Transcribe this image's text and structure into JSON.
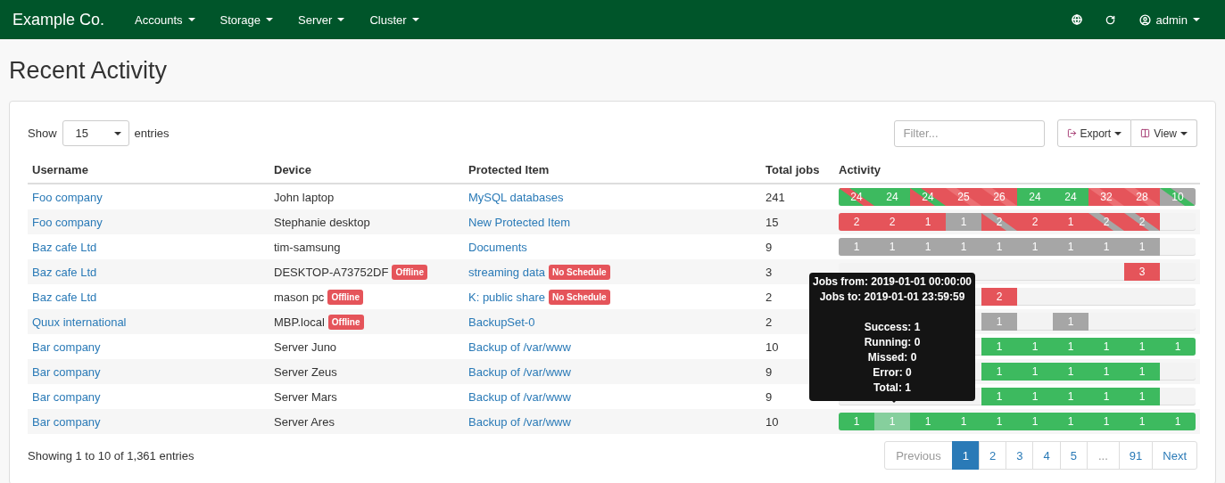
{
  "navbar": {
    "brand": "Example Co.",
    "menus": [
      {
        "label": "Accounts"
      },
      {
        "label": "Storage"
      },
      {
        "label": "Server"
      },
      {
        "label": "Cluster"
      }
    ],
    "user": "admin"
  },
  "page_title": "Recent Activity",
  "controls": {
    "show_label": "Show",
    "page_size": "15",
    "entries_label": "entries",
    "filter_placeholder": "Filter...",
    "export": "Export",
    "view": "View"
  },
  "table": {
    "columns": [
      "Username",
      "Device",
      "Protected Item",
      "Total jobs",
      "Activity"
    ],
    "rows": [
      {
        "username": "Foo company",
        "device": "John laptop",
        "item": "MySQL databases",
        "total": "241",
        "activity": [
          {
            "kind": "jobs",
            "label": "24",
            "color": "#3dba5f",
            "accent": {
              "color": "#e5545a"
            }
          },
          {
            "kind": "jobs",
            "label": "24",
            "color": "#3dba5f"
          },
          {
            "kind": "jobs",
            "label": "24",
            "color": "#e5545a",
            "accent": {
              "color": "#3dba5f"
            }
          },
          {
            "kind": "jobs",
            "label": "25",
            "color": "#e5545a",
            "accent": {
              "color": "#ec6f73"
            }
          },
          {
            "kind": "jobs",
            "label": "26",
            "color": "#e5545a",
            "accent": {
              "color": "#ec6f73"
            }
          },
          {
            "kind": "jobs",
            "label": "24",
            "color": "#3dba5f"
          },
          {
            "kind": "jobs",
            "label": "24",
            "color": "#3dba5f"
          },
          {
            "kind": "jobs",
            "label": "32",
            "color": "#e5545a",
            "accent": {
              "color": "#ec6f73"
            }
          },
          {
            "kind": "jobs",
            "label": "28",
            "color": "#e5545a",
            "accent": {
              "color": "#ec6f73"
            }
          },
          {
            "kind": "jobs",
            "label": "10",
            "color": "#a6a6a6",
            "accent": {
              "color": "#3dba5f"
            }
          }
        ]
      },
      {
        "username": "Foo company",
        "device": "Stephanie desktop",
        "item": "New Protected Item",
        "total": "15",
        "activity": [
          {
            "kind": "jobs",
            "label": "2",
            "color": "#e5545a"
          },
          {
            "kind": "jobs",
            "label": "2",
            "color": "#e5545a"
          },
          {
            "kind": "jobs",
            "label": "1",
            "color": "#e5545a"
          },
          {
            "kind": "jobs",
            "label": "1",
            "color": "#a6a6a6"
          },
          {
            "kind": "jobs",
            "label": "2",
            "color": "#e5545a",
            "accent": {
              "color": "#a6a6a6"
            }
          },
          {
            "kind": "jobs",
            "label": "2",
            "color": "#e5545a"
          },
          {
            "kind": "jobs",
            "label": "1",
            "color": "#e5545a"
          },
          {
            "kind": "jobs",
            "label": "2",
            "color": "#e5545a",
            "accent": {
              "color": "#a6a6a6"
            }
          },
          {
            "kind": "jobs",
            "label": "2",
            "color": "#e5545a",
            "accent": {
              "color": "#a6a6a6"
            }
          },
          {
            "kind": "empty"
          }
        ]
      },
      {
        "username": "Baz cafe Ltd",
        "device": "tim-samsung",
        "item": "Documents",
        "total": "9",
        "activity": [
          {
            "kind": "jobs",
            "label": "1",
            "color": "#a6a6a6"
          },
          {
            "kind": "jobs",
            "label": "1",
            "color": "#a6a6a6"
          },
          {
            "kind": "jobs",
            "label": "1",
            "color": "#a6a6a6"
          },
          {
            "kind": "jobs",
            "label": "1",
            "color": "#a6a6a6"
          },
          {
            "kind": "jobs",
            "label": "1",
            "color": "#a6a6a6"
          },
          {
            "kind": "jobs",
            "label": "1",
            "color": "#a6a6a6"
          },
          {
            "kind": "jobs",
            "label": "1",
            "color": "#a6a6a6"
          },
          {
            "kind": "jobs",
            "label": "1",
            "color": "#a6a6a6"
          },
          {
            "kind": "jobs",
            "label": "1",
            "color": "#a6a6a6"
          },
          {
            "kind": "empty"
          }
        ]
      },
      {
        "username": "Baz cafe Ltd",
        "device": "DESKTOP-A73752DF",
        "device_badge": "Offline",
        "item": "streaming data",
        "item_badge": "No Schedule",
        "total": "3",
        "activity": [
          {
            "kind": "empty"
          },
          {
            "kind": "empty"
          },
          {
            "kind": "empty"
          },
          {
            "kind": "empty"
          },
          {
            "kind": "empty"
          },
          {
            "kind": "empty"
          },
          {
            "kind": "empty"
          },
          {
            "kind": "empty"
          },
          {
            "kind": "jobs",
            "label": "3",
            "color": "#e5545a"
          },
          {
            "kind": "empty"
          }
        ]
      },
      {
        "username": "Baz cafe Ltd",
        "device": "mason pc",
        "device_badge": "Offline",
        "item": "K: public share",
        "item_badge": "No Schedule",
        "total": "2",
        "activity": [
          {
            "kind": "empty"
          },
          {
            "kind": "empty"
          },
          {
            "kind": "empty"
          },
          {
            "kind": "empty"
          },
          {
            "kind": "jobs",
            "label": "2",
            "color": "#e5545a"
          },
          {
            "kind": "empty"
          },
          {
            "kind": "empty"
          },
          {
            "kind": "empty"
          },
          {
            "kind": "empty"
          },
          {
            "kind": "empty"
          }
        ]
      },
      {
        "username": "Quux international",
        "device": "MBP.local",
        "device_badge": "Offline",
        "item": "BackupSet-0",
        "total": "2",
        "activity": [
          {
            "kind": "empty"
          },
          {
            "kind": "empty"
          },
          {
            "kind": "empty"
          },
          {
            "kind": "empty"
          },
          {
            "kind": "jobs",
            "label": "1",
            "color": "#a6a6a6"
          },
          {
            "kind": "empty"
          },
          {
            "kind": "jobs",
            "label": "1",
            "color": "#a6a6a6"
          },
          {
            "kind": "empty"
          },
          {
            "kind": "empty"
          },
          {
            "kind": "empty"
          }
        ]
      },
      {
        "username": "Bar company",
        "device": "Server Juno",
        "item": "Backup of /var/www",
        "total": "10",
        "activity": [
          {
            "kind": "empty"
          },
          {
            "kind": "empty"
          },
          {
            "kind": "empty"
          },
          {
            "kind": "empty"
          },
          {
            "kind": "jobs",
            "label": "1",
            "color": "#3dba5f"
          },
          {
            "kind": "jobs",
            "label": "1",
            "color": "#3dba5f"
          },
          {
            "kind": "jobs",
            "label": "1",
            "color": "#3dba5f"
          },
          {
            "kind": "jobs",
            "label": "1",
            "color": "#3dba5f"
          },
          {
            "kind": "jobs",
            "label": "1",
            "color": "#3dba5f"
          },
          {
            "kind": "jobs",
            "label": "1",
            "color": "#3dba5f"
          }
        ]
      },
      {
        "username": "Bar company",
        "device": "Server Zeus",
        "item": "Backup of /var/www",
        "total": "9",
        "activity": [
          {
            "kind": "empty"
          },
          {
            "kind": "empty"
          },
          {
            "kind": "empty"
          },
          {
            "kind": "empty"
          },
          {
            "kind": "jobs",
            "label": "1",
            "color": "#3dba5f"
          },
          {
            "kind": "jobs",
            "label": "1",
            "color": "#3dba5f"
          },
          {
            "kind": "jobs",
            "label": "1",
            "color": "#3dba5f"
          },
          {
            "kind": "jobs",
            "label": "1",
            "color": "#3dba5f"
          },
          {
            "kind": "jobs",
            "label": "1",
            "color": "#3dba5f"
          },
          {
            "kind": "empty"
          }
        ]
      },
      {
        "username": "Bar company",
        "device": "Server Mars",
        "item": "Backup of /var/www",
        "total": "9",
        "activity": [
          {
            "kind": "empty"
          },
          {
            "kind": "empty"
          },
          {
            "kind": "empty"
          },
          {
            "kind": "empty"
          },
          {
            "kind": "jobs",
            "label": "1",
            "color": "#3dba5f"
          },
          {
            "kind": "jobs",
            "label": "1",
            "color": "#3dba5f"
          },
          {
            "kind": "jobs",
            "label": "1",
            "color": "#3dba5f"
          },
          {
            "kind": "jobs",
            "label": "1",
            "color": "#3dba5f"
          },
          {
            "kind": "jobs",
            "label": "1",
            "color": "#3dba5f"
          },
          {
            "kind": "empty"
          }
        ]
      },
      {
        "username": "Bar company",
        "device": "Server Ares",
        "item": "Backup of /var/www",
        "total": "10",
        "activity": [
          {
            "kind": "jobs",
            "label": "1",
            "color": "#3dba5f"
          },
          {
            "kind": "jobs",
            "label": "1",
            "color": "#86cf9d"
          },
          {
            "kind": "jobs",
            "label": "1",
            "color": "#3dba5f"
          },
          {
            "kind": "jobs",
            "label": "1",
            "color": "#3dba5f"
          },
          {
            "kind": "jobs",
            "label": "1",
            "color": "#3dba5f"
          },
          {
            "kind": "jobs",
            "label": "1",
            "color": "#3dba5f"
          },
          {
            "kind": "jobs",
            "label": "1",
            "color": "#3dba5f"
          },
          {
            "kind": "jobs",
            "label": "1",
            "color": "#3dba5f"
          },
          {
            "kind": "jobs",
            "label": "1",
            "color": "#3dba5f"
          },
          {
            "kind": "jobs",
            "label": "1",
            "color": "#3dba5f"
          }
        ]
      }
    ]
  },
  "tooltip": {
    "lines": [
      "Jobs from: 2019-01-01 00:00:00",
      "Jobs to: 2019-01-01 23:59:59"
    ],
    "stats": [
      "Success: 1",
      "Running: 0",
      "Missed: 0",
      "Error: 0",
      "Total: 1"
    ]
  },
  "footer": {
    "summary": "Showing 1 to 10 of 1,361 entries",
    "pages": [
      {
        "label": "Previous",
        "kind": "disabled",
        "selected": false
      },
      {
        "label": "1",
        "kind": "page",
        "selected": true
      },
      {
        "label": "2",
        "kind": "page",
        "selected": false
      },
      {
        "label": "3",
        "kind": "page",
        "selected": false
      },
      {
        "label": "4",
        "kind": "page",
        "selected": false
      },
      {
        "label": "5",
        "kind": "page",
        "selected": false
      },
      {
        "label": "...",
        "kind": "disabled",
        "selected": false
      },
      {
        "label": "91",
        "kind": "page",
        "selected": false
      },
      {
        "label": "Next",
        "kind": "page",
        "selected": false
      }
    ]
  }
}
